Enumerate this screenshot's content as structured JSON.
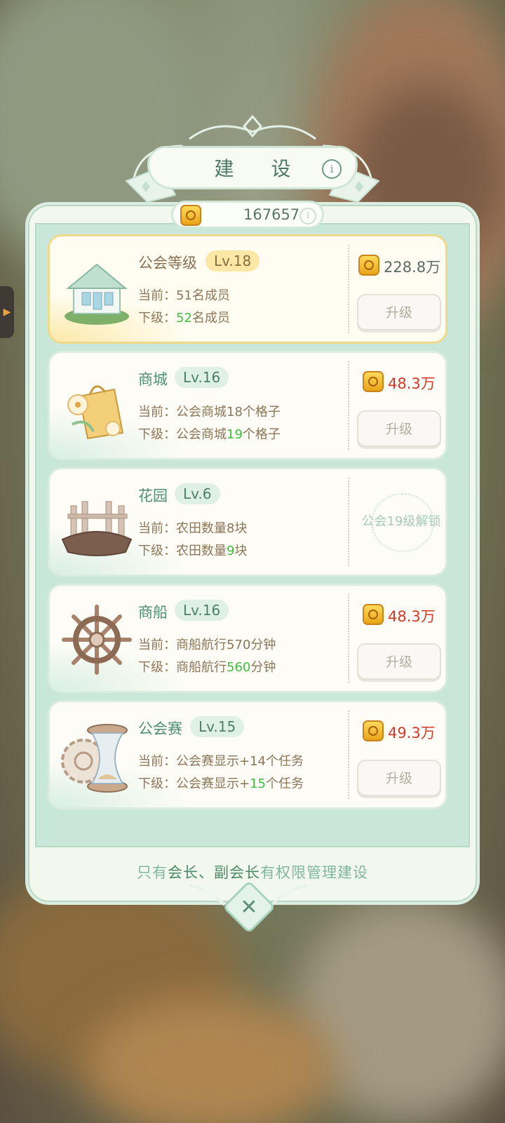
{
  "title": "建 设",
  "currency": {
    "value": "167657"
  },
  "cards": [
    {
      "name": "公会等级",
      "level": "Lv.18",
      "current_label": "当前：",
      "current_text": "51名成员",
      "next_label": "下级：",
      "next_pre": "",
      "next_hl": "52",
      "next_post": "名成员",
      "cost": "228.8万",
      "button": "升级"
    },
    {
      "name": "商城",
      "level": "Lv.16",
      "current_label": "当前：",
      "current_text": "公会商城18个格子",
      "next_label": "下级：",
      "next_pre": "公会商城",
      "next_hl": "19",
      "next_post": "个格子",
      "cost": "48.3万",
      "button": "升级"
    },
    {
      "name": "花园",
      "level": "Lv.6",
      "current_label": "当前：",
      "current_text": "农田数量8块",
      "next_label": "下级：",
      "next_pre": "农田数量",
      "next_hl": "9",
      "next_post": "块",
      "lock_text": "公会19级解锁"
    },
    {
      "name": "商船",
      "level": "Lv.16",
      "current_label": "当前：",
      "current_text": "商船航行570分钟",
      "next_label": "下级：",
      "next_pre": "商船航行",
      "next_hl": "560",
      "next_post": "分钟",
      "cost": "48.3万",
      "button": "升级"
    },
    {
      "name": "公会赛",
      "level": "Lv.15",
      "current_label": "当前：",
      "current_text": "公会赛显示+14个任务",
      "next_label": "下级：",
      "next_pre": "公会赛显示+",
      "next_hl": "15",
      "next_post": "个任务",
      "cost": "49.3万",
      "button": "升级"
    }
  ],
  "footer": {
    "part1": "只有",
    "part2": "会长、副会长",
    "part3": "有权限管理建设"
  },
  "colors": {
    "accent_green": "#4f8f70",
    "highlight_green": "#3fbf3f",
    "cost_red": "#d23a28",
    "coin_gold": "#e9a419"
  },
  "icons": [
    "coin-icon",
    "info-icon",
    "close-icon",
    "guild-house-icon",
    "shop-bag-icon",
    "garden-fence-icon",
    "ship-wheel-icon",
    "hourglass-gear-icon"
  ]
}
